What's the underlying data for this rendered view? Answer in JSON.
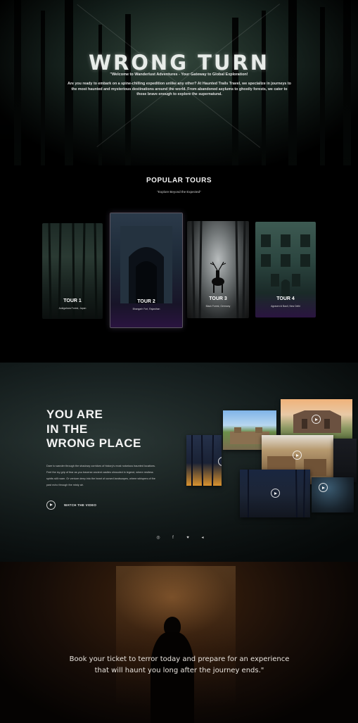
{
  "hero": {
    "title": "WRONG TURN",
    "tagline": "\"Welcome to Wanderlust Adventures - Your Gateway to Global Exploration!",
    "description": "Are you ready to embark on a spine-chilling expedition unlike any other? At Haunted Trails Travel, we specialize in journeys to the most haunted and mysterious destinations around the world. From abandoned asylums to ghostly forests, we cater to those brave enough to explore the supernatural."
  },
  "tours": {
    "title": "POPULAR TOURS",
    "subtitle": "\"Explore Beyond the Expected\"",
    "items": [
      {
        "name": "TOUR 1",
        "location": "Aokigahara Forest, Japan"
      },
      {
        "name": "TOUR 2",
        "location": "Bhangarh Fort, Rajasthan"
      },
      {
        "name": "TOUR 3",
        "location": "Black Forest, Germany"
      },
      {
        "name": "TOUR 4",
        "location": "Agrasen ki Baoli, New Delhi"
      }
    ]
  },
  "wrong_place": {
    "title_lines": [
      "YOU ARE",
      "IN THE",
      "WRONG PLACE"
    ],
    "text": "Dare to wander through the shadowy corridors of history's most notorious haunted locations. Feel the icy grip of fear as you traverse ancient castles shrouded in legend, where restless spirits still roam. Or venture deep into the heart of cursed landscapes, where whispers of the past echo through the misty air.",
    "watch_label": "WATCH THE VIDEO",
    "social": [
      "instagram-icon",
      "facebook-icon",
      "twitter-icon",
      "telegram-icon"
    ],
    "social_glyphs": [
      "◎",
      "f",
      "♥",
      "◂"
    ]
  },
  "cta": {
    "quote": "Book your ticket to terror today and prepare for an experience that will haunt you long after the journey ends.\""
  },
  "colors": {
    "background": "#000000",
    "accent_purple": "#2a1440",
    "text": "#ffffff"
  }
}
